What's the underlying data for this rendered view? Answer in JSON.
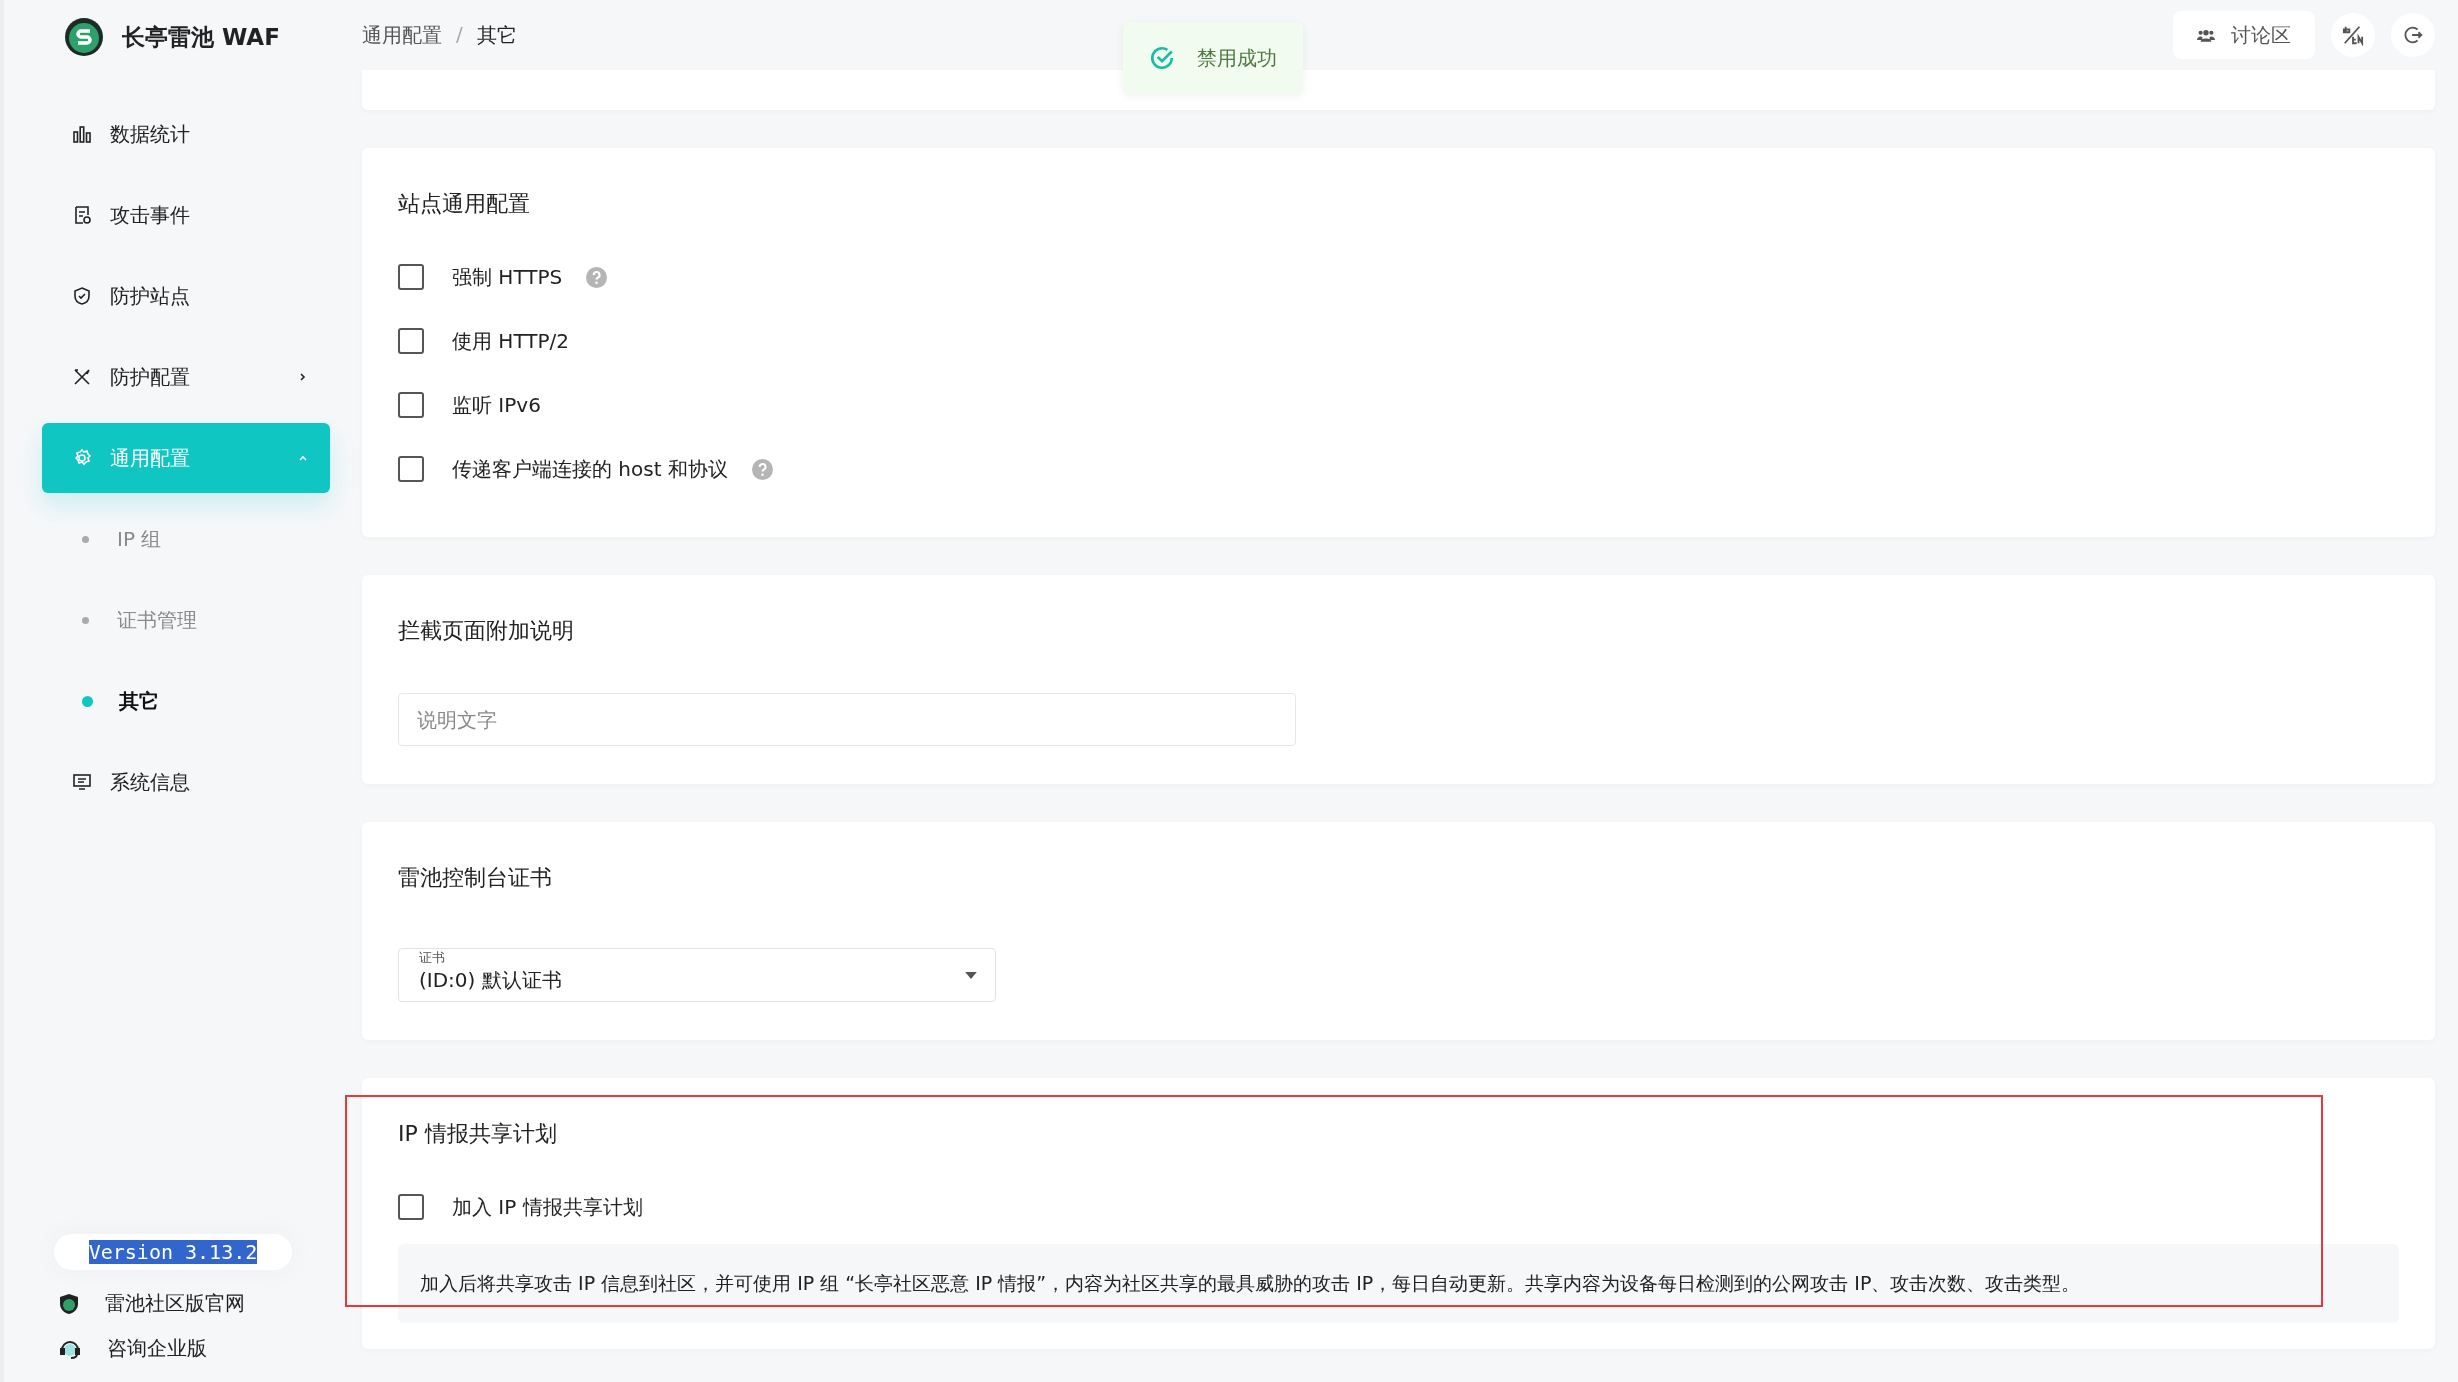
{
  "brand": {
    "name": "长亭雷池 WAF"
  },
  "nav": [
    {
      "label": "数据统计",
      "kind": "item",
      "selected": false
    },
    {
      "label": "攻击事件",
      "kind": "item",
      "selected": false
    },
    {
      "label": "防护站点",
      "kind": "item",
      "selected": false
    },
    {
      "label": "防护配置",
      "kind": "group",
      "selected": false,
      "expanded": false
    },
    {
      "label": "通用配置",
      "kind": "group",
      "selected": true,
      "expanded": true,
      "children": [
        {
          "label": "IP 组",
          "selected": false
        },
        {
          "label": "证书管理",
          "selected": false
        },
        {
          "label": "其它",
          "selected": true
        }
      ]
    },
    {
      "label": "系统信息",
      "kind": "item",
      "selected": false
    }
  ],
  "sidebar_footer": {
    "version": "Version 3.13.2",
    "version_text_selected": true,
    "links": [
      "雷池社区版官网",
      "咨询企业版"
    ]
  },
  "breadcrumb": [
    "通用配置",
    "其它"
  ],
  "breadcrumb_separator": "/",
  "toast": {
    "text": "禁用成功"
  },
  "header_buttons": {
    "forum": "讨论区"
  },
  "sections": [
    {
      "kind": "checkboxes",
      "title": "站点通用配置",
      "highlighted": false,
      "options": [
        {
          "label": "强制 HTTPS",
          "checked": false,
          "help": true
        },
        {
          "label": "使用 HTTP/2",
          "checked": false,
          "help": false
        },
        {
          "label": "监听 IPv6",
          "checked": false,
          "help": false
        },
        {
          "label": "传递客户端连接的 host 和协议",
          "checked": false,
          "help": true
        }
      ]
    },
    {
      "kind": "text_input",
      "title": "拦截页面附加说明",
      "highlighted": false,
      "placeholder": "说明文字"
    },
    {
      "kind": "select",
      "title": "雷池控制台证书",
      "highlighted": false,
      "field_label": "证书",
      "value": "(ID:0) 默认证书"
    },
    {
      "kind": "checkboxes",
      "title": "IP 情报共享计划",
      "highlighted": true,
      "options": [
        {
          "label": "加入 IP 情报共享计划",
          "checked": false,
          "help": false
        }
      ],
      "note": "加入后将共享攻击 IP 信息到社区，并可使用 IP 组 “长亭社区恶意 IP 情报”，内容为社区共享的最具威胁的攻击 IP，每日自动更新。共享内容为设备每日检测到的公网攻击 IP、攻击次数、攻击类型。"
    }
  ]
}
